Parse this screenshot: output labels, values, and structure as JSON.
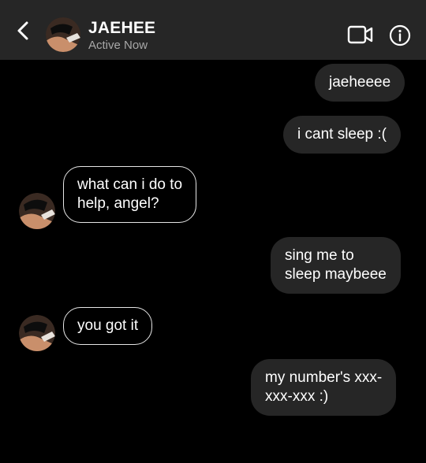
{
  "header": {
    "title": "JAEHEE",
    "status": "Active Now"
  },
  "messages": [
    {
      "side": "sent",
      "text": "jaeheeee"
    },
    {
      "side": "sent",
      "text": "i cant sleep :("
    },
    {
      "side": "received",
      "lines": [
        "what can i do to",
        "help, angel?"
      ]
    },
    {
      "side": "sent",
      "lines": [
        "sing me to",
        "sleep maybeee"
      ]
    },
    {
      "side": "received",
      "text": "you got it"
    },
    {
      "side": "sent",
      "lines": [
        "my number's xxx-",
        "xxx-xxx :)"
      ]
    }
  ],
  "icons": {
    "back": "chevron-left-icon",
    "video": "video-camera-icon",
    "info": "info-icon"
  },
  "colors": {
    "background": "#000000",
    "header": "#262626",
    "sent_bubble": "#262626",
    "received_border": "#e6e6e6",
    "status_text": "#a8a8a8"
  }
}
